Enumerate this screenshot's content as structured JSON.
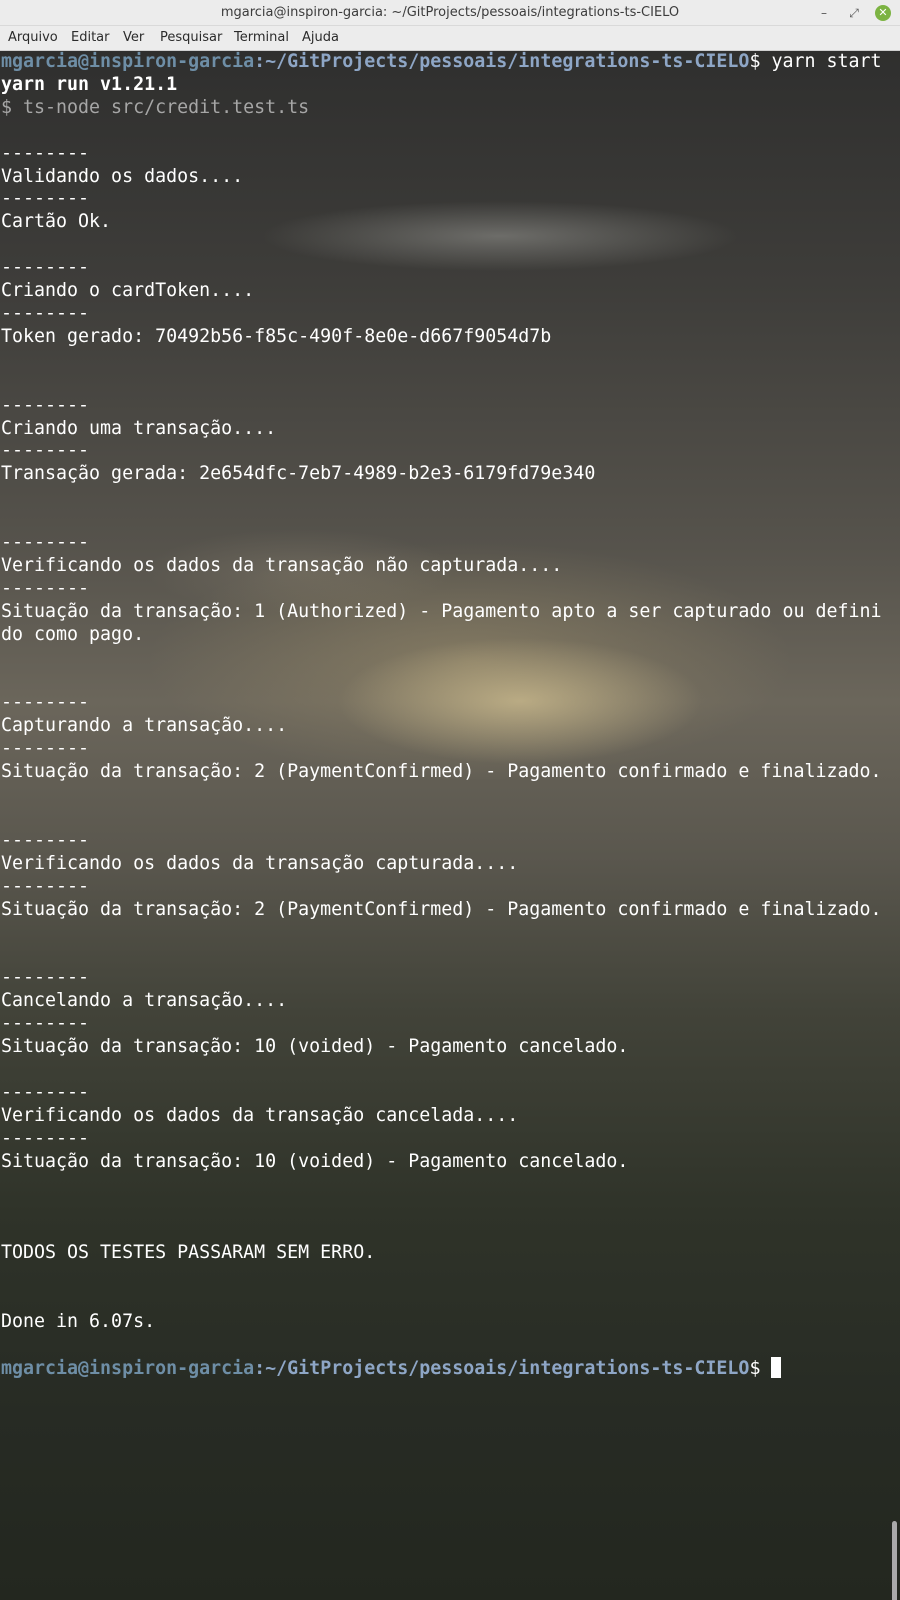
{
  "window": {
    "title": "mgarcia@inspiron-garcia: ~/GitProjects/pessoais/integrations-ts-CIELO",
    "controls": {
      "minimize": "–",
      "maximize": "⤢",
      "close": "✕"
    }
  },
  "menu": [
    "Arquivo",
    "Editar",
    "Ver",
    "Pesquisar",
    "Terminal",
    "Ajuda"
  ],
  "terminal": {
    "prompt": {
      "user_host": "mgarcia@inspiron-garcia",
      "path": ":~/GitProjects/pessoais/integrations-ts-CIELO",
      "symbol": "$ "
    },
    "command": "yarn start",
    "yarn_version_line": "yarn run v1.21.1",
    "script_line": "$ ts-node src/credit.test.ts",
    "output": [
      "",
      "--------",
      "Validando os dados....",
      "--------",
      "Cartão Ok.",
      "",
      "--------",
      "Criando o cardToken....",
      "--------",
      "Token gerado: 70492b56-f85c-490f-8e0e-d667f9054d7b",
      "",
      "",
      "--------",
      "Criando uma transação....",
      "--------",
      "Transação gerada: 2e654dfc-7eb7-4989-b2e3-6179fd79e340",
      "",
      "",
      "--------",
      "Verificando os dados da transação não capturada....",
      "--------",
      "Situação da transação: 1 (Authorized) - Pagamento apto a ser capturado ou defini",
      "do como pago.",
      "",
      "",
      "--------",
      "Capturando a transação....",
      "--------",
      "Situação da transação: 2 (PaymentConfirmed) - Pagamento confirmado e finalizado.",
      "",
      "",
      "--------",
      "Verificando os dados da transação capturada....",
      "--------",
      "Situação da transação: 2 (PaymentConfirmed) - Pagamento confirmado e finalizado.",
      "",
      "",
      "--------",
      "Cancelando a transação....",
      "--------",
      "Situação da transação: 10 (voided) - Pagamento cancelado.",
      "",
      "--------",
      "Verificando os dados da transação cancelada....",
      "--------",
      "Situação da transação: 10 (voided) - Pagamento cancelado.",
      "",
      "",
      "",
      "TODOS OS TESTES PASSARAM SEM ERRO.",
      "",
      "",
      "Done in 6.07s."
    ]
  }
}
